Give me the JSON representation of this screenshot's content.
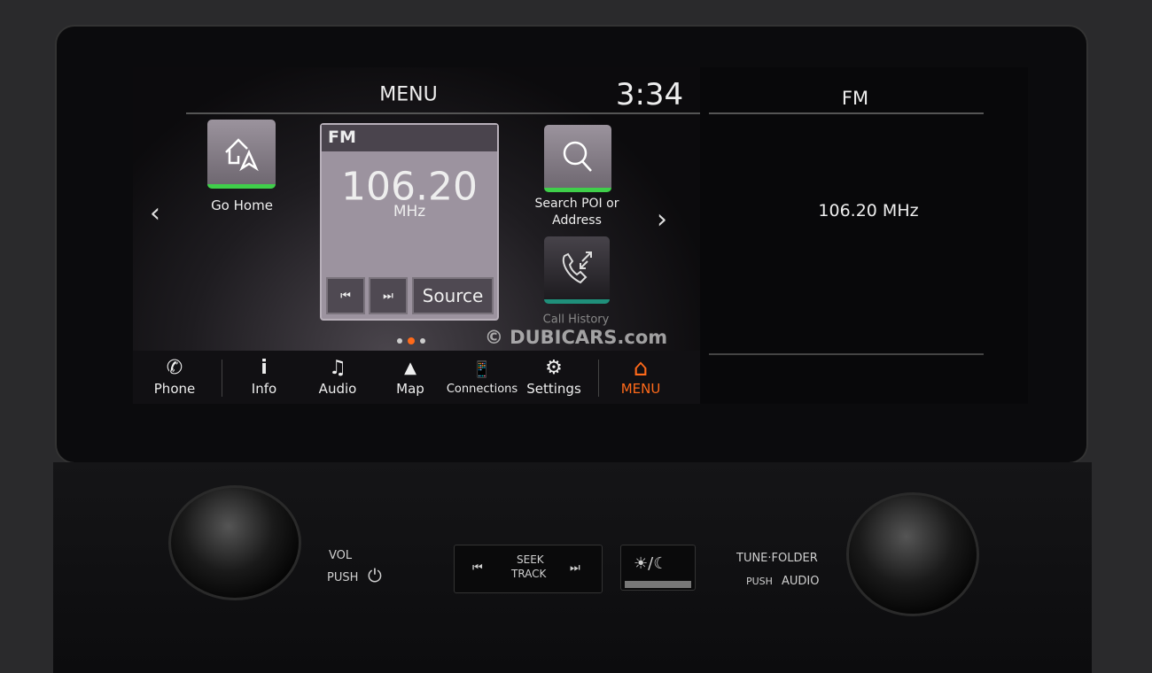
{
  "header": {
    "title": "MENU",
    "clock": "3:34"
  },
  "tiles": {
    "go_home": "Go Home",
    "search_line1": "Search POI or",
    "search_line2": "Address",
    "call_history": "Call History"
  },
  "radio_card": {
    "band": "FM",
    "frequency": "106.20",
    "unit": "MHz",
    "source_label": "Source",
    "prev_icon": "⏮",
    "next_icon": "⏭"
  },
  "page_indicator": {
    "pages": 3,
    "active": 2
  },
  "nav": {
    "items": [
      {
        "label": "Phone",
        "icon": "✆"
      },
      {
        "label": "Info",
        "icon": "i"
      },
      {
        "label": "Audio",
        "icon": "♫"
      },
      {
        "label": "Map",
        "icon": "▲"
      },
      {
        "label": "Connections",
        "icon": "📱"
      },
      {
        "label": "Settings",
        "icon": "⚙"
      },
      {
        "label": "MENU",
        "icon": "⌂"
      }
    ],
    "active_color": "#ff6a1a"
  },
  "right_pane": {
    "title": "FM",
    "station": "106.20 MHz"
  },
  "watermark": "© DUBICARS.com",
  "hardware": {
    "vol": "VOL",
    "push": "PUSH",
    "power_icon": "⏻",
    "seek": "SEEK",
    "track": "TRACK",
    "seek_prev": "⏮",
    "seek_next": "⏭",
    "day_night": "☀/☾",
    "tune_folder": "TUNE·FOLDER",
    "push2": "PUSH",
    "audio": "AUDIO"
  },
  "colors": {
    "accent_green": "#3fcf4a",
    "accent_orange": "#ff6a1a"
  }
}
